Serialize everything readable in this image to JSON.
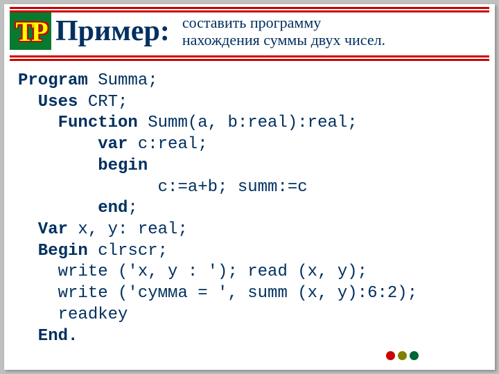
{
  "logo": "TP",
  "title": "Пример:",
  "subtitle_line1": "составить программу",
  "subtitle_line2": "нахождения суммы двух чисел.",
  "code": {
    "l1a": "Program",
    "l1b": " Summa;",
    "l2a": "  Uses",
    "l2b": " CRT;",
    "l3a": "    Function",
    "l3b": " Summ(a, b:real):real;",
    "l4a": "        var",
    "l4b": " c:real;",
    "l5a": "        begin",
    "l6": "              c:=a+b; summ:=c",
    "l7a": "        end",
    "l7b": ";",
    "l8a": "  Var",
    "l8b": " x, y: real;",
    "l9a": "  Begin",
    "l9b": " clrscr;",
    "l10": "    write ('x, y : '); read (x, y);",
    "l11": "    write ('сумма = ', summ (x, y):6:2);",
    "l12": "    readkey",
    "l13": "  End."
  }
}
